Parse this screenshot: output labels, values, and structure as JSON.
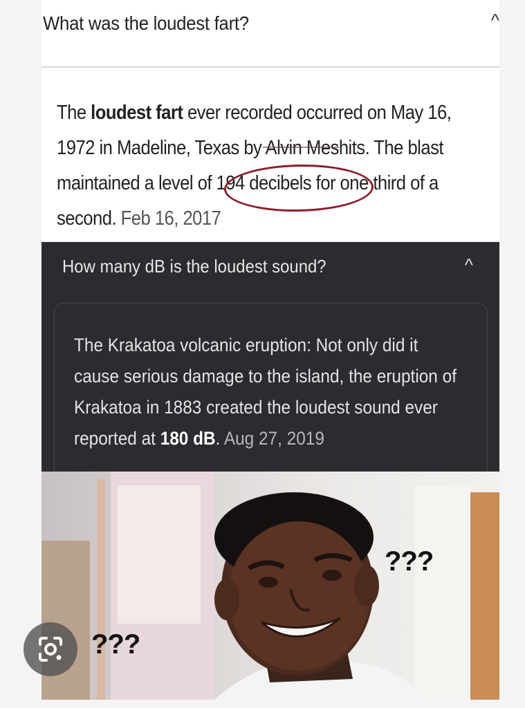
{
  "q1": {
    "question": "What was the loudest fart?",
    "chevron": "^",
    "answer_lines": [
      [
        "The ",
        "loudest fart",
        " ever recorded occurred on May 16,"
      ],
      [
        "1972 in Madeline, Texas by Alvin Meshits. The blast"
      ],
      [
        "maintained a level of 194 decibels for one third of a"
      ],
      [
        "second. ",
        "Feb 16, 2017"
      ]
    ]
  },
  "q2": {
    "question": "How many dB is the loudest sound?",
    "chevron": "^",
    "answer_lines": [
      [
        "The Krakatoa volcanic eruption: Not only did it"
      ],
      [
        "cause serious damage to the island, the eruption of"
      ],
      [
        "Krakatoa in 1883 created the loudest sound ever"
      ],
      [
        "reported at ",
        "180 dB",
        ". ",
        "Aug 27, 2019"
      ]
    ]
  },
  "meme": {
    "qmarks_right": "???",
    "qmarks_left": "???"
  },
  "colors": {
    "circle": "#8a1e28",
    "dark_panel": "#2b2c30"
  },
  "icons": {
    "lens_button": "google-lens-icon"
  }
}
